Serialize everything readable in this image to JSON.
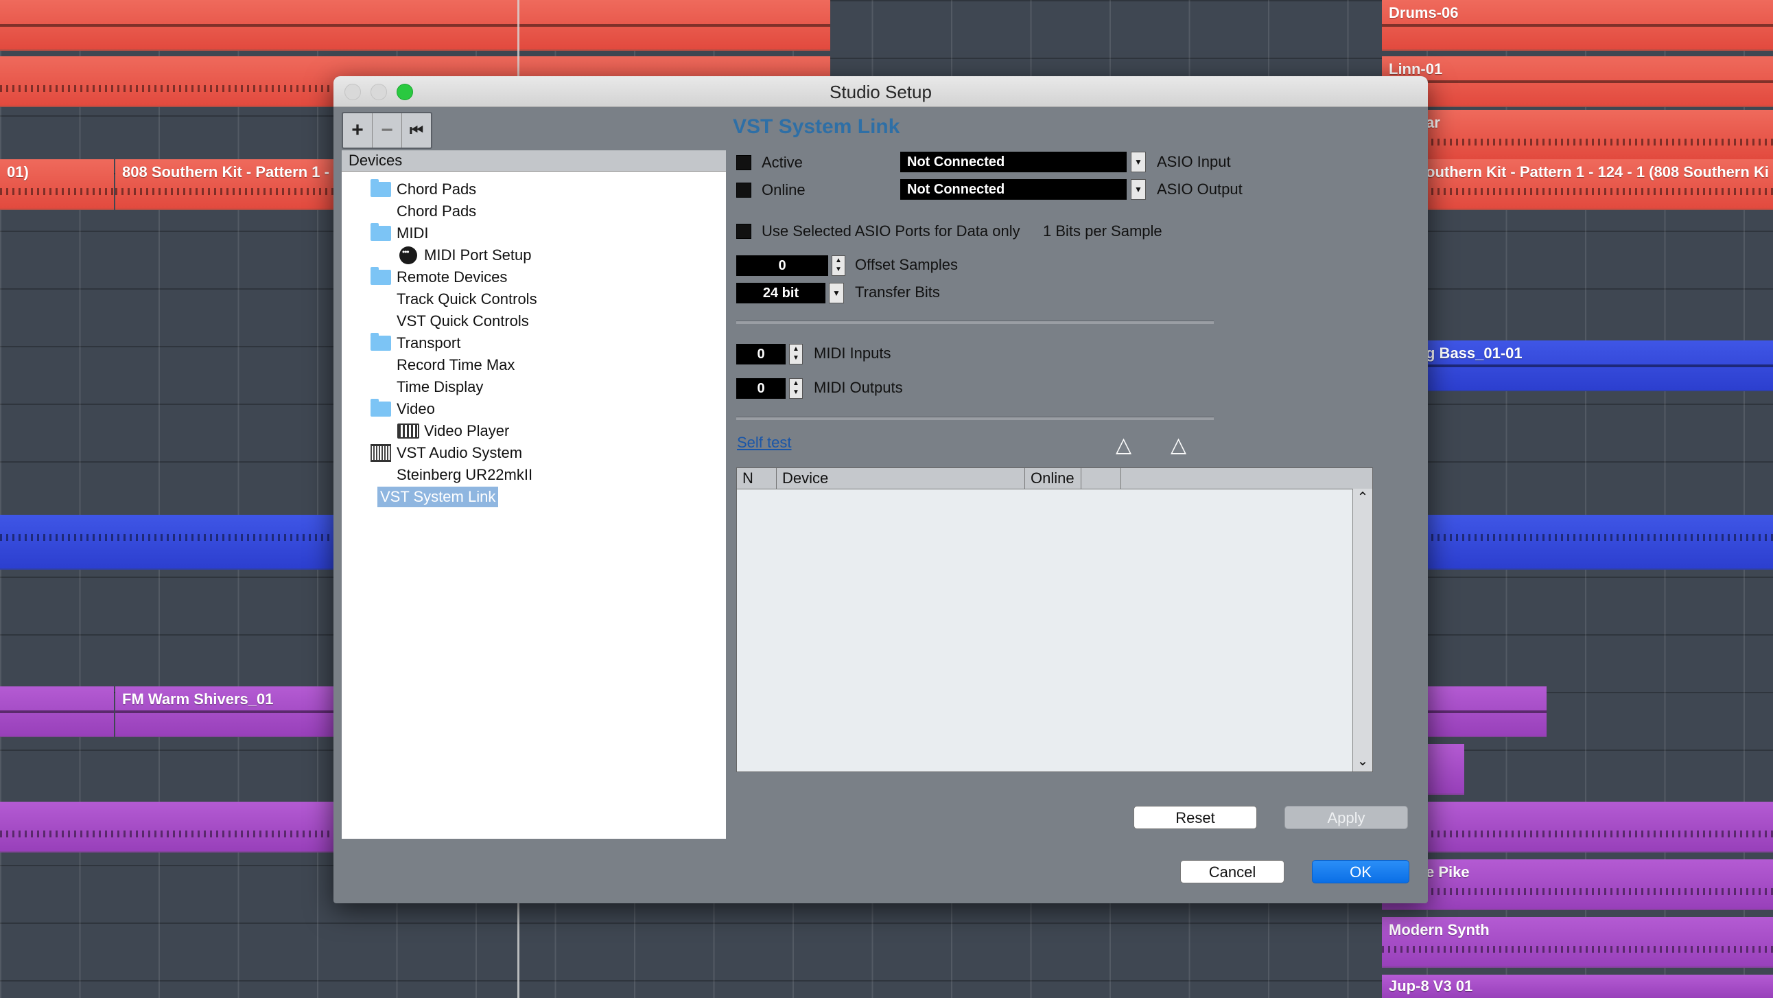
{
  "background": {
    "clips": [
      {
        "name": "Drums-06",
        "color": "red"
      },
      {
        "name": "Linn-01",
        "color": "red"
      },
      {
        "name": "ar",
        "color": "red"
      },
      {
        "name": "01)",
        "color": "red"
      },
      {
        "name": "808 Southern Kit - Pattern 1 -",
        "color": "red"
      },
      {
        "name": "outhern Kit - Pattern 1 - 124 - 1 (808 Southern Ki",
        "color": "red"
      },
      {
        "name": "g Bass_01-01",
        "color": "blue"
      },
      {
        "name": "FM Warm Shivers_01",
        "color": "purple"
      },
      {
        "name": "e Pike",
        "color": "purple"
      },
      {
        "name": "Modern Synth",
        "color": "purple"
      },
      {
        "name": "Jup-8 V3 01",
        "color": "purple"
      }
    ]
  },
  "dialog": {
    "title": "Studio Setup",
    "toolbar": {
      "add": "+",
      "remove": "−",
      "reset": "⏮"
    },
    "tree_header": "Devices",
    "tree": [
      {
        "label": "Chord Pads",
        "icon": "folder-icon"
      },
      {
        "label": "Chord Pads",
        "icon": ""
      },
      {
        "label": "MIDI",
        "icon": "folder-icon"
      },
      {
        "label": "MIDI Port Setup",
        "icon": "midi-port-icon"
      },
      {
        "label": "Remote Devices",
        "icon": "folder-icon"
      },
      {
        "label": "Track Quick Controls",
        "icon": ""
      },
      {
        "label": "VST Quick Controls",
        "icon": ""
      },
      {
        "label": "Transport",
        "icon": "folder-icon"
      },
      {
        "label": "Record Time Max",
        "icon": ""
      },
      {
        "label": "Time Display",
        "icon": ""
      },
      {
        "label": "Video",
        "icon": "folder-icon"
      },
      {
        "label": "Video Player",
        "icon": "video-player-icon"
      },
      {
        "label": "VST Audio System",
        "icon": "audio-system-icon"
      },
      {
        "label": "Steinberg UR22mkII",
        "icon": ""
      },
      {
        "label": "VST System Link",
        "icon": "",
        "selected": true
      }
    ],
    "panel": {
      "title": "VST System Link",
      "active_label": "Active",
      "online_label": "Online",
      "asio_input_value": "Not Connected",
      "asio_input_label": "ASIO Input",
      "asio_output_value": "Not Connected",
      "asio_output_label": "ASIO Output",
      "use_selected_label": "Use Selected ASIO Ports for Data only",
      "bits_per_sample": "1 Bits per Sample",
      "offset_samples_value": "0",
      "offset_samples_label": "Offset Samples",
      "transfer_bits_value": "24 bit",
      "transfer_bits_label": "Transfer Bits",
      "midi_inputs_value": "0",
      "midi_inputs_label": "MIDI Inputs",
      "midi_outputs_value": "0",
      "midi_outputs_label": "MIDI Outputs",
      "self_test": "Self test",
      "table_columns": [
        "N",
        "Device",
        "Online",
        ""
      ]
    },
    "buttons": {
      "reset": "Reset",
      "apply": "Apply",
      "cancel": "Cancel",
      "ok": "OK"
    }
  }
}
